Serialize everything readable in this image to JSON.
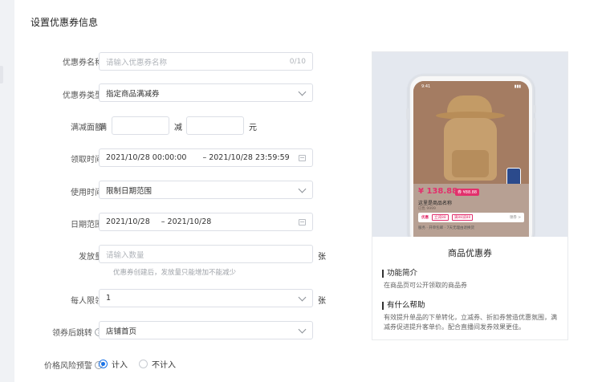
{
  "title": "设置优惠券信息",
  "form": {
    "name_label": "优惠券名称",
    "name_placeholder": "请输入优惠券名称",
    "name_counter": "0/10",
    "type_label": "优惠券类型",
    "type_value": "指定商品满减券",
    "amount_label": "满减面额",
    "amount_man": "满",
    "amount_jian": "减",
    "amount_unit": "元",
    "claim_label": "领取时间",
    "claim_start": "2021/10/28 00:00:00",
    "claim_end": "– 2021/10/28 23:59:59",
    "use_label": "使用时间",
    "use_value": "限制日期范围",
    "range_label": "日期范围",
    "range_start": "2021/10/28",
    "range_end": "– 2021/10/28",
    "issue_label": "发放量",
    "issue_placeholder": "请输入数量",
    "issue_unit": "张",
    "issue_hint": "优惠券创建后，发放量只能增加不能减少",
    "limit_label": "每人限领",
    "limit_value": "1",
    "limit_unit": "张",
    "jump_label": "领券后跳转",
    "jump_value": "店铺首页",
    "risk_label": "价格风险预警",
    "risk_option_on": "计入",
    "risk_option_off": "不计入",
    "help_glyph": "?"
  },
  "preview": {
    "time": "9:41",
    "price": "¥ 138.88",
    "coupon_tag": "券 ¥88.88",
    "product_name": "这里是商品名称",
    "sub_text": "已售 9999",
    "strip_label": "优惠",
    "strip_coupon_1": "立减88",
    "strip_coupon_2": "满88减88",
    "strip_more": "领券 >",
    "service_text": "服务  · 开单包邮 · 7天无理由退换货",
    "title": "商品优惠券",
    "sec1_title": "功能简介",
    "sec1_text": "在商品页可公开领取的商品券",
    "sec2_title": "有什么帮助",
    "sec2_text": "有效提升单品的下单转化，立减券、折扣券营造优惠氛围，满减券促进提升客单价。配合直播间发券效果更佳。"
  }
}
